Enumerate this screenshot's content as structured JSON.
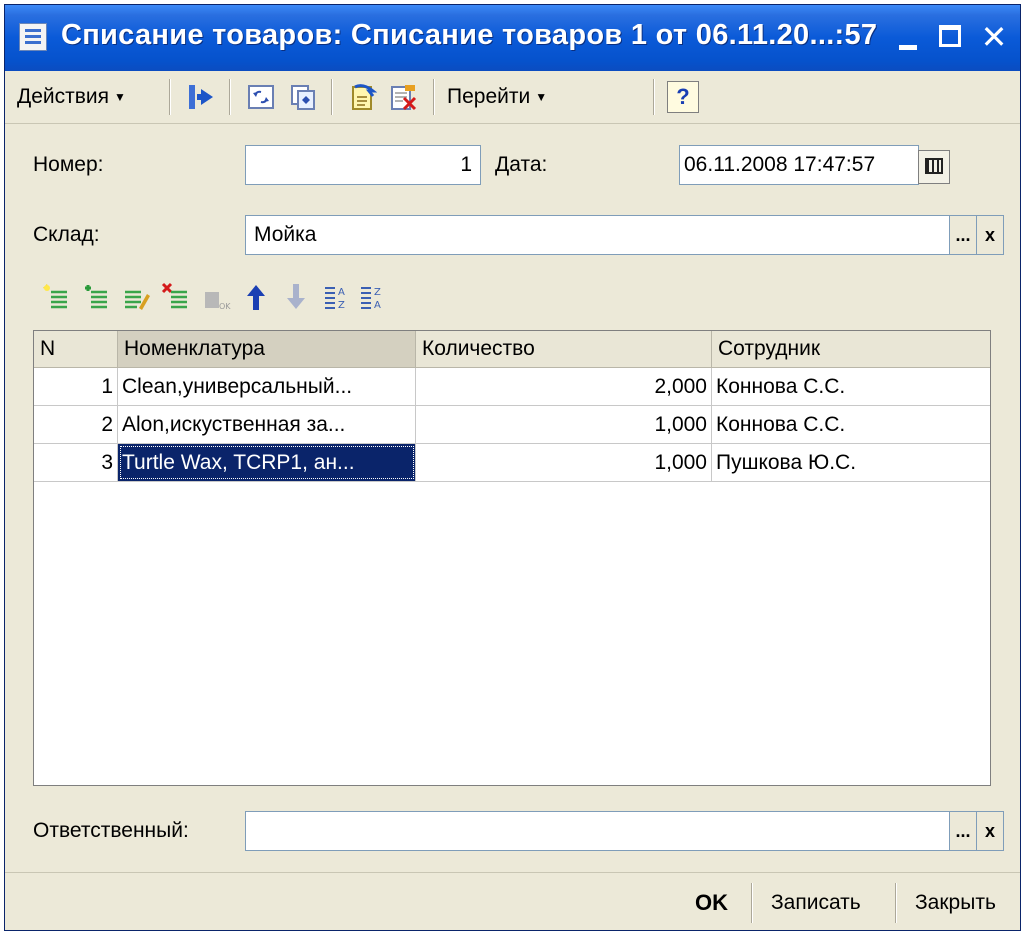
{
  "window": {
    "title": "Списание товаров: Списание товаров 1 от 06.11.20...:57",
    "close_glyph": "✕"
  },
  "toolbar": {
    "actions_label": "Действия",
    "goto_label": "Перейти",
    "help_label": "?"
  },
  "form": {
    "number_label": "Номер:",
    "number_value": "1",
    "date_label": "Дата:",
    "date_value": "06.11.2008 17:47:57",
    "warehouse_label": "Склад:",
    "warehouse_value": "Мойка",
    "responsible_label": "Ответственный:",
    "responsible_value": "",
    "select_glyph": "...",
    "clear_glyph": "x"
  },
  "table": {
    "columns": [
      "N",
      "Номенклатура",
      "Количество",
      "Сотрудник"
    ],
    "rows": [
      {
        "n": "1",
        "item": "Clean,универсальный...",
        "qty": "2,000",
        "employee": "Коннова С.С."
      },
      {
        "n": "2",
        "item": "Alon,искуственная за...",
        "qty": "1,000",
        "employee": "Коннова С.С."
      },
      {
        "n": "3",
        "item": "Turtle Wax, TCRP1, ан...",
        "qty": "1,000",
        "employee": "Пушкова Ю.С."
      }
    ],
    "selected_row": 3
  },
  "footer": {
    "ok_label": "OK",
    "save_label": "Записать",
    "close_label": "Закрыть"
  },
  "colors": {
    "titlebar": "#0a5ad8",
    "selection": "#0a246a",
    "window_bg": "#ece9d8"
  }
}
